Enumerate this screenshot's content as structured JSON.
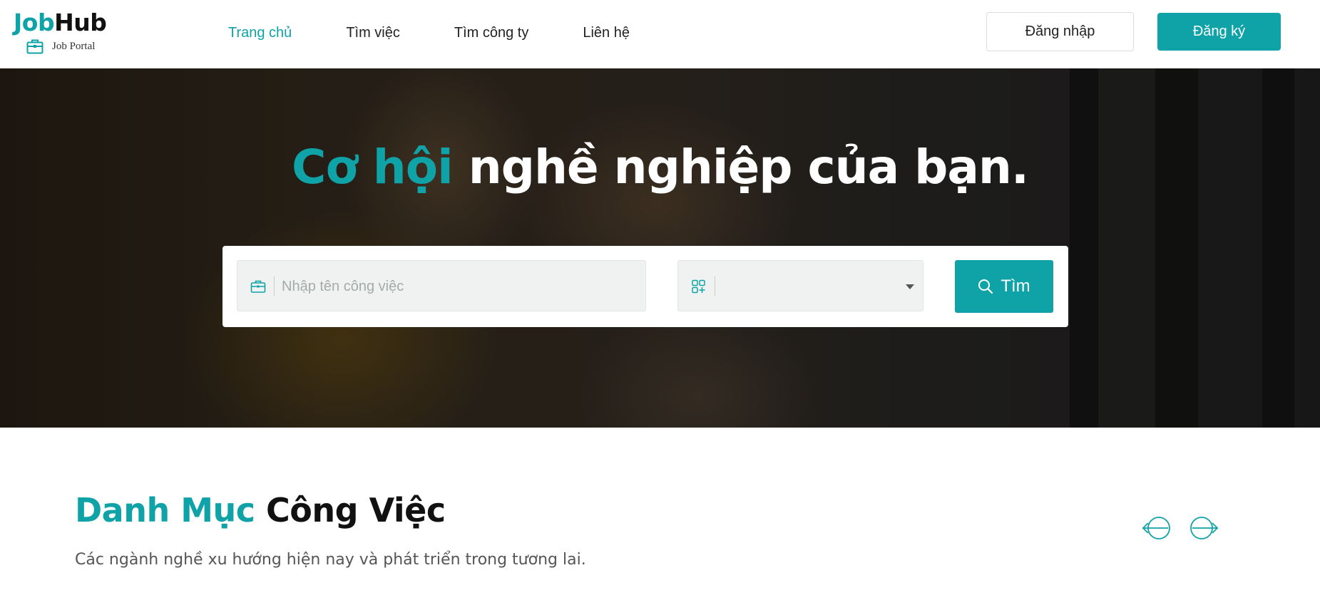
{
  "brand": {
    "name_part1": "Job",
    "name_part2": "Hub",
    "tagline": "Job Portal",
    "accent_color": "#0fa3a8"
  },
  "nav": {
    "items": [
      {
        "label": "Trang chủ",
        "active": true
      },
      {
        "label": "Tìm việc",
        "active": false
      },
      {
        "label": "Tìm công ty",
        "active": false
      },
      {
        "label": "Liên hệ",
        "active": false
      }
    ]
  },
  "auth": {
    "login_label": "Đăng nhập",
    "register_label": "Đăng ký"
  },
  "hero": {
    "title_accent": "Cơ hội",
    "title_rest": "nghề nghiệp của bạn."
  },
  "search": {
    "job_placeholder": "Nhập tên công việc",
    "job_value": "",
    "category_value": "",
    "job_icon": "briefcase-icon",
    "category_icon": "grid-add-icon",
    "button_label": "Tìm",
    "button_icon": "search-icon"
  },
  "categories": {
    "title_accent": "Danh Mục",
    "title_rest": "Công Việc",
    "subtitle": "Các ngành nghề xu hướng hiện nay và phát triển trong tương lai.",
    "prev_icon": "arrow-left-circle-icon",
    "next_icon": "arrow-right-circle-icon"
  }
}
